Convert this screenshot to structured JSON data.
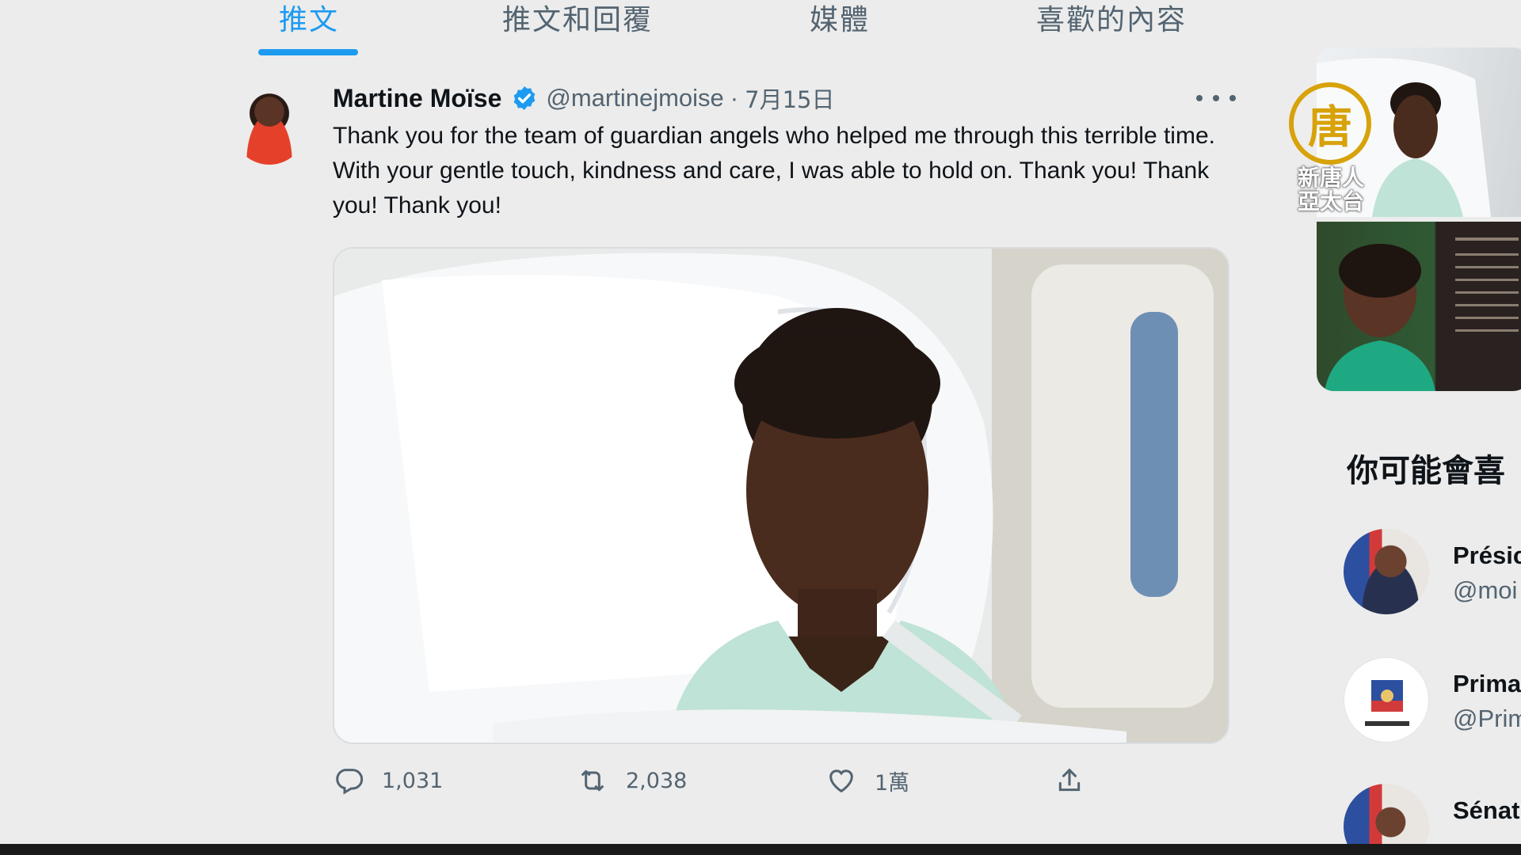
{
  "tabs": [
    {
      "label": "推文",
      "active": true
    },
    {
      "label": "推文和回覆",
      "active": false
    },
    {
      "label": "媒體",
      "active": false
    },
    {
      "label": "喜歡的內容",
      "active": false
    }
  ],
  "tweet": {
    "display_name": "Martine Moïse",
    "handle": "@martinejmoise",
    "separator": "·",
    "date": "7月15日",
    "text": "Thank you for the team of guardian angels who helped me through this terrible time. With your gentle touch, kindness and care, I was able to hold on. Thank you! Thank you! Thank you!",
    "media_description_icon": "photo",
    "actions": {
      "reply_count": "1,031",
      "retweet_count": "2,038",
      "like_count": "1萬"
    }
  },
  "sidebar": {
    "watermark_logo_char": "唐",
    "watermark_text": "新唐人\n亞太台",
    "who_to_follow_title": "你可能會喜",
    "suggestions": [
      {
        "name": "Présic",
        "handle": "@moi"
      },
      {
        "name": "Prima",
        "handle": "@Prim"
      },
      {
        "name": "Sénat",
        "handle": ""
      }
    ]
  },
  "colors": {
    "accent": "#1d9bf0",
    "text_primary": "#0f1419",
    "text_secondary": "#536471",
    "background": "#ececec",
    "logo_gold": "#d7a20a"
  }
}
